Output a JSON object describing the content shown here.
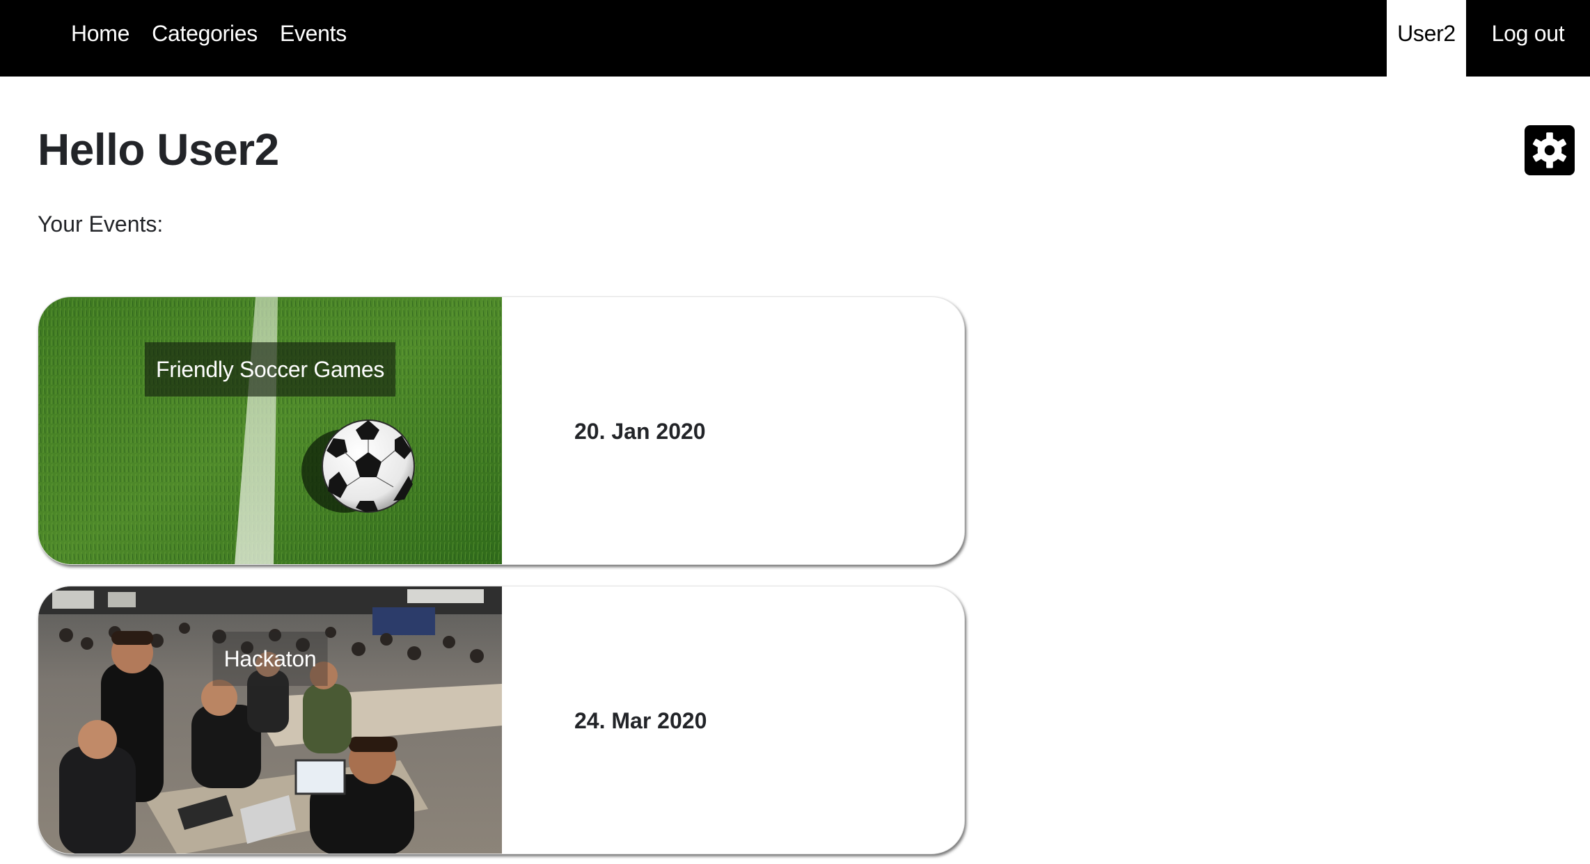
{
  "nav": {
    "links": [
      {
        "label": "Home"
      },
      {
        "label": "Categories"
      },
      {
        "label": "Events"
      }
    ],
    "user_label": "User2",
    "logout_label": "Log out"
  },
  "page": {
    "greeting": "Hello User2",
    "events_label": "Your Events:",
    "settings_icon": "gear-icon"
  },
  "events": [
    {
      "title": "Friendly Soccer Games",
      "date": "20. Jan 2020",
      "image": "soccer-ball-on-grass-photo"
    },
    {
      "title": "Hackaton",
      "date": "24. Mar 2020",
      "image": "hackathon-crowd-photo"
    }
  ],
  "colors": {
    "navbar": "#000000",
    "active_user_tab": "#ffffff",
    "text": "#222428",
    "grass": "#3f7d22"
  }
}
